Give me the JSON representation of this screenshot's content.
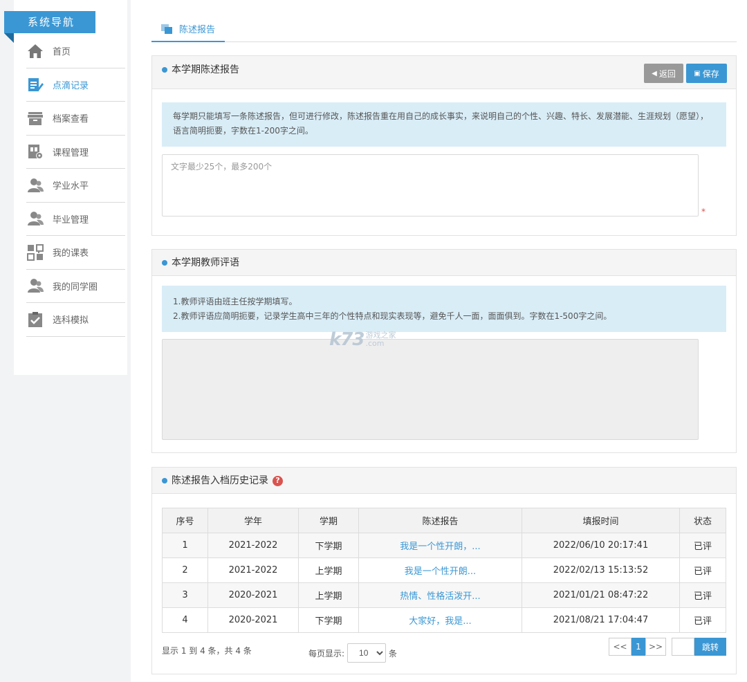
{
  "sidebar": {
    "title": "系统导航",
    "items": [
      {
        "label": "首页",
        "icon": "home-icon"
      },
      {
        "label": "点滴记录",
        "icon": "edit-icon",
        "active": true
      },
      {
        "label": "档案查看",
        "icon": "archive-icon"
      },
      {
        "label": "课程管理",
        "icon": "course-icon"
      },
      {
        "label": "学业水平",
        "icon": "user-icon"
      },
      {
        "label": "毕业管理",
        "icon": "user-icon"
      },
      {
        "label": "我的课表",
        "icon": "schedule-icon"
      },
      {
        "label": "我的同学圈",
        "icon": "user-icon"
      },
      {
        "label": "选科模拟",
        "icon": "clipboard-check-icon"
      }
    ]
  },
  "tab": {
    "label": "陈述报告"
  },
  "report_panel": {
    "title": "本学期陈述报告",
    "back_label": "返回",
    "save_label": "保存",
    "info": "每学期只能填写一条陈述报告，但可进行修改，陈述报告重在用自己的成长事实，来说明自己的个性、兴趣、特长、发展潜能、生涯规划（愿望），语言简明扼要，字数在1-200字之间。",
    "placeholder": "文字最少25个，最多200个",
    "required_mark": "*"
  },
  "comment_panel": {
    "title": "本学期教师评语",
    "info_line1": "1.教师评语由班主任按学期填写。",
    "info_line2": "2.教师评语应简明扼要，记录学生高中三年的个性特点和现实表现等，避免千人一面，面面俱到。字数在1-500字之间。"
  },
  "watermark": {
    "big": "k73",
    "small1": "游戏之家",
    "small2": ".com"
  },
  "history_panel": {
    "title": "陈述报告入档历史记录",
    "help_glyph": "?",
    "columns": [
      "序号",
      "学年",
      "学期",
      "陈述报告",
      "填报时间",
      "状态"
    ],
    "rows": [
      [
        "1",
        "2021-2022",
        "下学期",
        "我是一个性开朗，...",
        "2022/06/10 20:17:41",
        "已评"
      ],
      [
        "2",
        "2021-2022",
        "上学期",
        "我是一个性开朗...",
        "2022/02/13 15:13:52",
        "已评"
      ],
      [
        "3",
        "2020-2021",
        "上学期",
        "热情、性格活泼开...",
        "2021/01/21 08:47:22",
        "已评"
      ],
      [
        "4",
        "2020-2021",
        "下学期",
        "大家好，我是...",
        "2021/08/21 17:04:47",
        "已评"
      ]
    ],
    "footer_info": "显示 1 到 4 条，共 4 条",
    "page_size_prefix": "每页显示:",
    "page_size_value": "10",
    "page_size_suffix": "条",
    "pager_prev": "<<",
    "pager_current": "1",
    "pager_next": ">>",
    "jump_label": "跳转"
  },
  "colors": {
    "accent": "#3a97d4",
    "info_bg": "#d9edf7",
    "back_btn": "#999999",
    "required": "#d9534f"
  }
}
